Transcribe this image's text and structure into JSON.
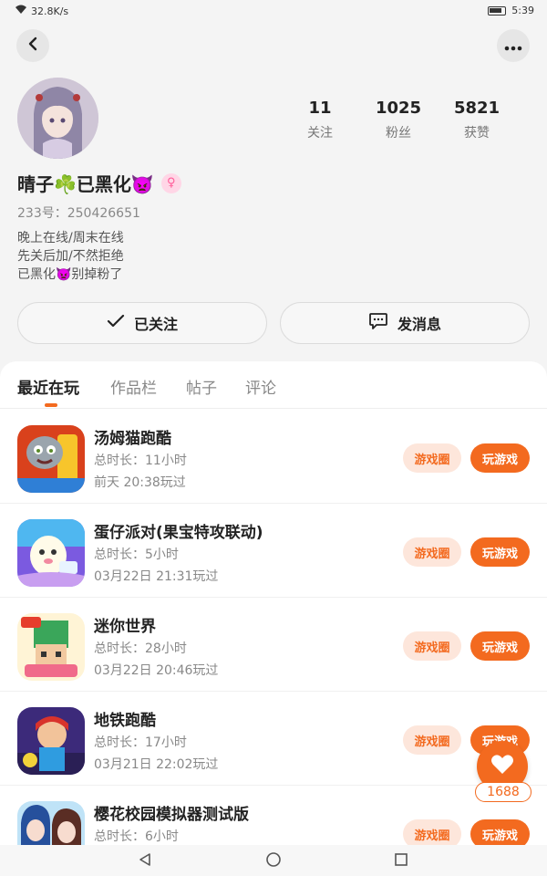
{
  "status_bar": {
    "network_speed": "32.8K/s",
    "time": "5:39"
  },
  "header": {
    "back_icon": "back-arrow-icon",
    "more_icon": "more-dots-icon"
  },
  "profile": {
    "name": "晴子☘️已黑化👿",
    "uid": "233号：250426651",
    "bio": [
      "晚上在线/周末在线",
      "先关后加/不然拒绝",
      "已黑化👿别掉粉了"
    ],
    "stats": [
      {
        "value": "11",
        "label": "关注"
      },
      {
        "value": "1025",
        "label": "粉丝"
      },
      {
        "value": "5821",
        "label": "获赞"
      }
    ]
  },
  "actions": {
    "follow_label": "已关注",
    "message_label": "发消息"
  },
  "tabs": [
    "最近在玩",
    "作品栏",
    "帖子",
    "评论"
  ],
  "games": [
    {
      "title": "汤姆猫跑酷",
      "duration": "总时长：11小时",
      "last_played": "前天 20:38玩过"
    },
    {
      "title": "蛋仔派对(果宝特攻联动)",
      "duration": "总时长：5小时",
      "last_played": "03月22日 21:31玩过"
    },
    {
      "title": "迷你世界",
      "duration": "总时长：28小时",
      "last_played": "03月22日 20:46玩过"
    },
    {
      "title": "地铁跑酷",
      "duration": "总时长：17小时",
      "last_played": "03月21日 22:02玩过"
    },
    {
      "title": "樱花校园模拟器测试版",
      "duration": "总时长：6小时",
      "last_played": ""
    }
  ],
  "game_buttons": {
    "circle_label": "游戏圈",
    "play_label": "玩游戏"
  },
  "like": {
    "count": "1688"
  },
  "colors": {
    "accent": "#f36a1f",
    "accent_light": "#fde6db"
  }
}
